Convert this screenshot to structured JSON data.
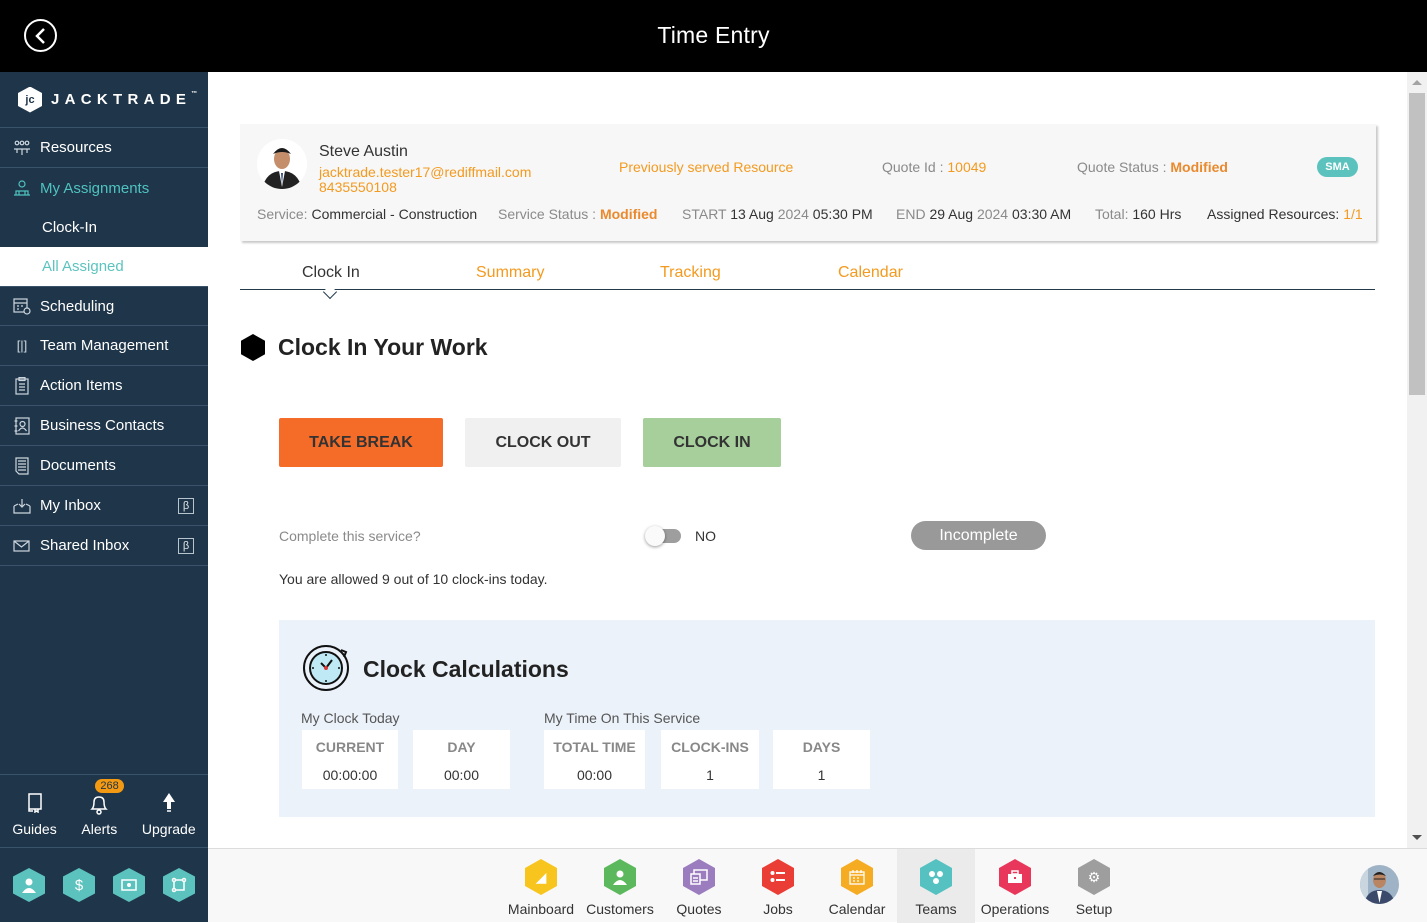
{
  "header": {
    "title": "Time Entry",
    "back_icon": "chevron-left-circle-icon"
  },
  "sidebar": {
    "logo_text": "JACKTRADE",
    "logo_tm": "™",
    "items": [
      {
        "label": "Resources",
        "icon": "resources-icon"
      },
      {
        "label": "My Assignments",
        "icon": "assignments-icon",
        "active": true,
        "subitems": [
          {
            "label": "Clock-In"
          },
          {
            "label": "All Assigned",
            "selected": true
          }
        ]
      },
      {
        "label": "Scheduling",
        "icon": "scheduling-icon"
      },
      {
        "label": "Team Management",
        "icon": "team-management-icon"
      },
      {
        "label": "Action Items",
        "icon": "action-items-icon"
      },
      {
        "label": "Business Contacts",
        "icon": "business-contacts-icon"
      },
      {
        "label": "Documents",
        "icon": "documents-icon"
      },
      {
        "label": "My Inbox",
        "icon": "inbox-icon",
        "badge": "β"
      },
      {
        "label": "Shared Inbox",
        "icon": "shared-inbox-icon",
        "badge": "β"
      }
    ],
    "utilities": [
      {
        "label": "Guides",
        "icon": "book-icon"
      },
      {
        "label": "Alerts",
        "icon": "bell-icon",
        "count": "268"
      },
      {
        "label": "Upgrade",
        "icon": "arrow-up-icon"
      }
    ],
    "quick_icons": [
      "person-icon",
      "dollar-icon",
      "money-icon",
      "workflow-icon"
    ]
  },
  "resource_card": {
    "name": "Steve Austin",
    "email": "jacktrade.tester17@rediffmail.com",
    "phone": "8435550108",
    "previously_served": "Previously served Resource",
    "quote_id_label": "Quote Id : ",
    "quote_id": "10049",
    "quote_status_label": "Quote Status : ",
    "quote_status": "Modified",
    "badge": "SMA",
    "service_label": "Service: ",
    "service": "Commercial - Construction",
    "service_status_label": "Service Status : ",
    "service_status": "Modified",
    "start_label": "START ",
    "start_date": "13 Aug",
    "start_year": "2024",
    "start_time": "05:30 PM",
    "end_label": "END ",
    "end_date": "29 Aug",
    "end_year": "2024",
    "end_time": "03:30 AM",
    "total_label": "Total: ",
    "total": "160 Hrs",
    "assigned_label": "Assigned Resources: ",
    "assigned": "1/1"
  },
  "tabs": [
    {
      "label": "Clock In",
      "active": true
    },
    {
      "label": "Summary"
    },
    {
      "label": "Tracking"
    },
    {
      "label": "Calendar"
    }
  ],
  "clock_section": {
    "title": "Clock In Your Work",
    "buttons": {
      "take_break": "TAKE BREAK",
      "clock_out": "CLOCK OUT",
      "clock_in": "CLOCK IN"
    },
    "complete_label": "Complete this service?",
    "toggle_value": "NO",
    "status_pill": "Incomplete",
    "allowed_text": "You are allowed 9 out of 10 clock-ins today."
  },
  "calculations": {
    "title": "Clock Calculations",
    "today_label": "My Clock Today",
    "service_label": "My Time On This Service",
    "today": [
      {
        "label": "CURRENT",
        "value": "00:00:00"
      },
      {
        "label": "DAY",
        "value": "00:00"
      }
    ],
    "service": [
      {
        "label": "TOTAL TIME",
        "value": "00:00"
      },
      {
        "label": "CLOCK-INS",
        "value": "1"
      },
      {
        "label": "DAYS",
        "value": "1"
      }
    ]
  },
  "bottom_apps": [
    {
      "label": "Mainboard",
      "color": "#f7c51e"
    },
    {
      "label": "Customers",
      "color": "#5cb85c"
    },
    {
      "label": "Quotes",
      "color": "#9b7cbf"
    },
    {
      "label": "Jobs",
      "color": "#ea3d36"
    },
    {
      "label": "Calendar",
      "color": "#f5ac23"
    },
    {
      "label": "Teams",
      "color": "#55c1c0",
      "active": true
    },
    {
      "label": "Operations",
      "color": "#e8375a"
    },
    {
      "label": "Setup",
      "color": "#9e9e9e"
    }
  ],
  "colors": {
    "accent_orange": "#f39a1f",
    "sidebar_bg": "#1f3549",
    "teal": "#5bc2be"
  }
}
